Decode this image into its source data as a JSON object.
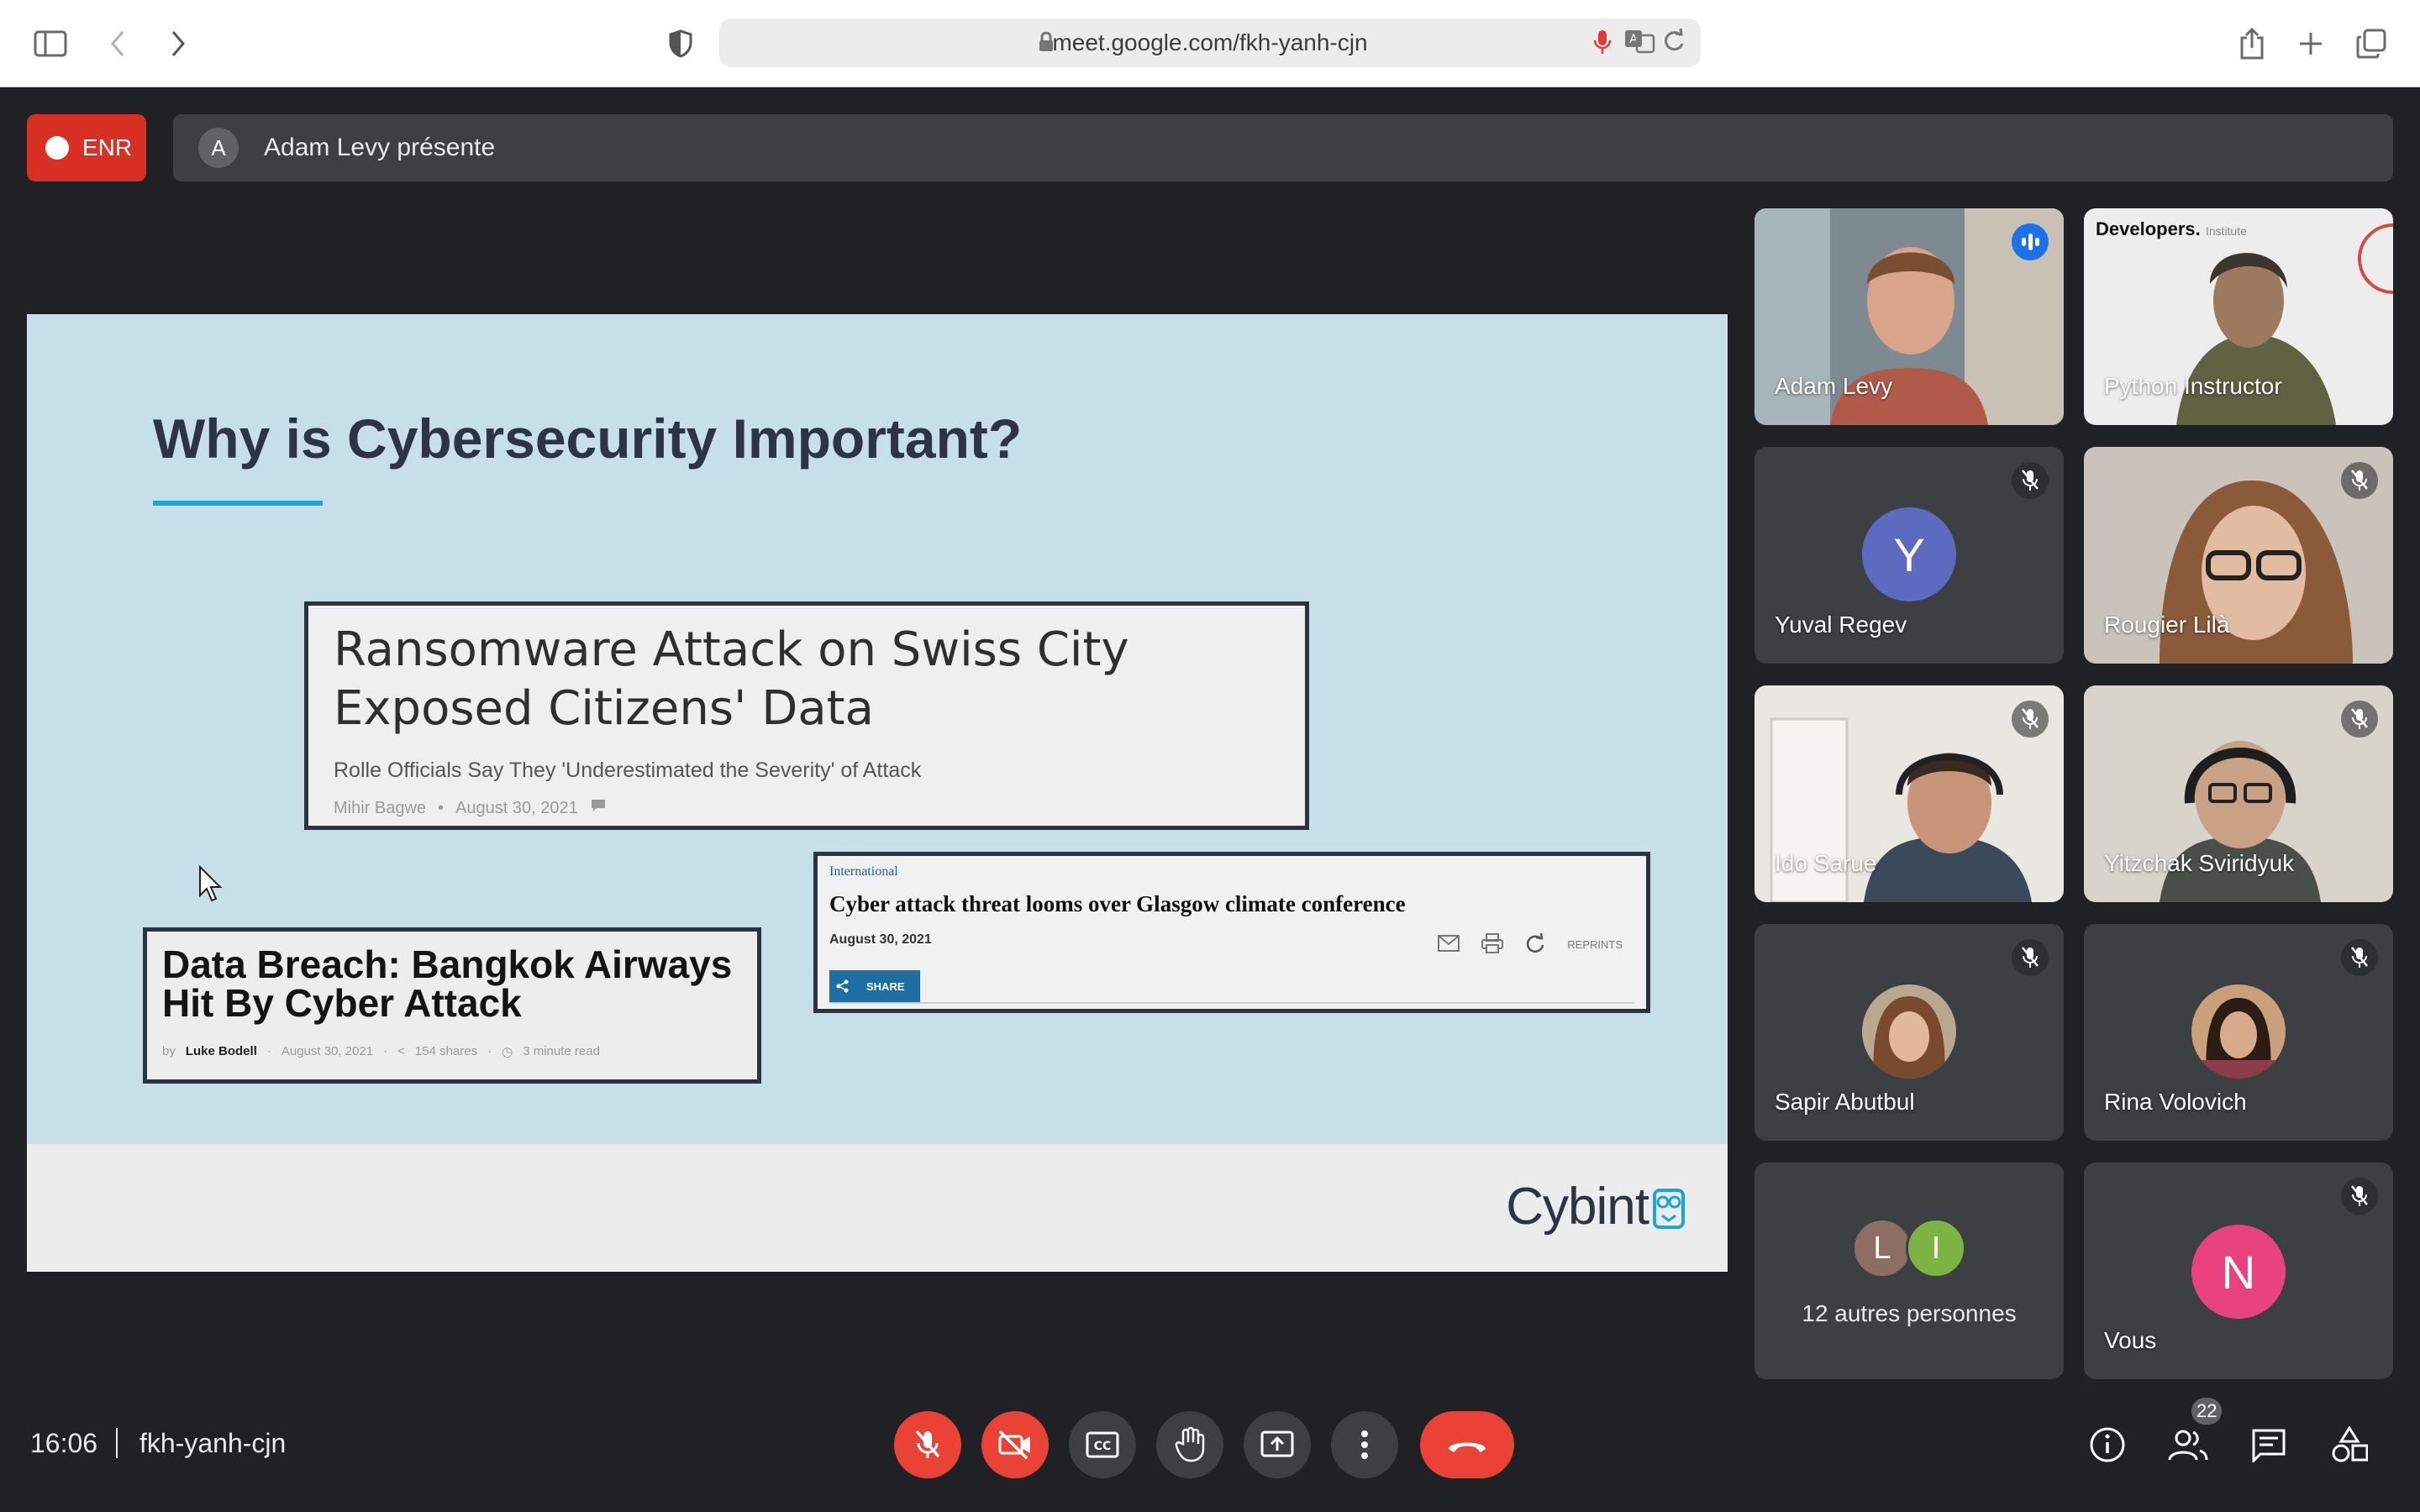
{
  "browser": {
    "url": "meet.google.com/fkh-yanh-cjn"
  },
  "recording": {
    "label": "ENR"
  },
  "presenter": {
    "initial": "A",
    "text": "Adam Levy présente"
  },
  "slide": {
    "title": "Why is Cybersecurity Important?",
    "article1": {
      "headline": "Ransomware Attack on Swiss City Exposed Citizens' Data",
      "subheadline": "Rolle Officials Say They 'Underestimated the Severity' of Attack",
      "author": "Mihir Bagwe",
      "date": "August 30, 2021"
    },
    "article2": {
      "headline": "Data Breach: Bangkok Airways Hit By Cyber Attack",
      "by": "by",
      "author": "Luke Bodell",
      "date": "August 30, 2021",
      "shares": "154 shares",
      "read_time": "3 minute read"
    },
    "article3": {
      "kicker": "International",
      "headline": "Cyber attack threat looms over Glasgow climate conference",
      "date": "August 30, 2021",
      "share_label": "SHARE",
      "reprints_label": "REPRINTS"
    },
    "logo": "Cybint"
  },
  "participants": [
    {
      "name": "Adam Levy",
      "state": "speaking"
    },
    {
      "name": "Python Instructor",
      "logo": "Developers.",
      "logo_suffix": "Institute"
    },
    {
      "name": "Yuval Regev",
      "initial": "Y",
      "color": "#5c6bc0",
      "muted": true
    },
    {
      "name": "Rougier Lilà",
      "muted": true
    },
    {
      "name": "Ido Sarue",
      "muted": true
    },
    {
      "name": "Yitzchak Sviridyuk",
      "muted": true
    },
    {
      "name": "Sapir Abutbul",
      "muted": true
    },
    {
      "name": "Rina Volovich",
      "muted": true
    },
    {
      "others_label": "12 autres personnes",
      "initials": [
        "L",
        "I"
      ],
      "colors": [
        "#8d6e63",
        "#7cb342"
      ]
    },
    {
      "name": "Vous",
      "initial": "N",
      "color": "#e8437f",
      "muted": true
    }
  ],
  "footer": {
    "time": "16:06",
    "meeting_code": "fkh-yanh-cjn",
    "participant_count": "22"
  },
  "colors": {
    "accent": "#8ab4f8",
    "danger": "#ea4335",
    "surface": "#3c4043",
    "background": "#202124"
  }
}
